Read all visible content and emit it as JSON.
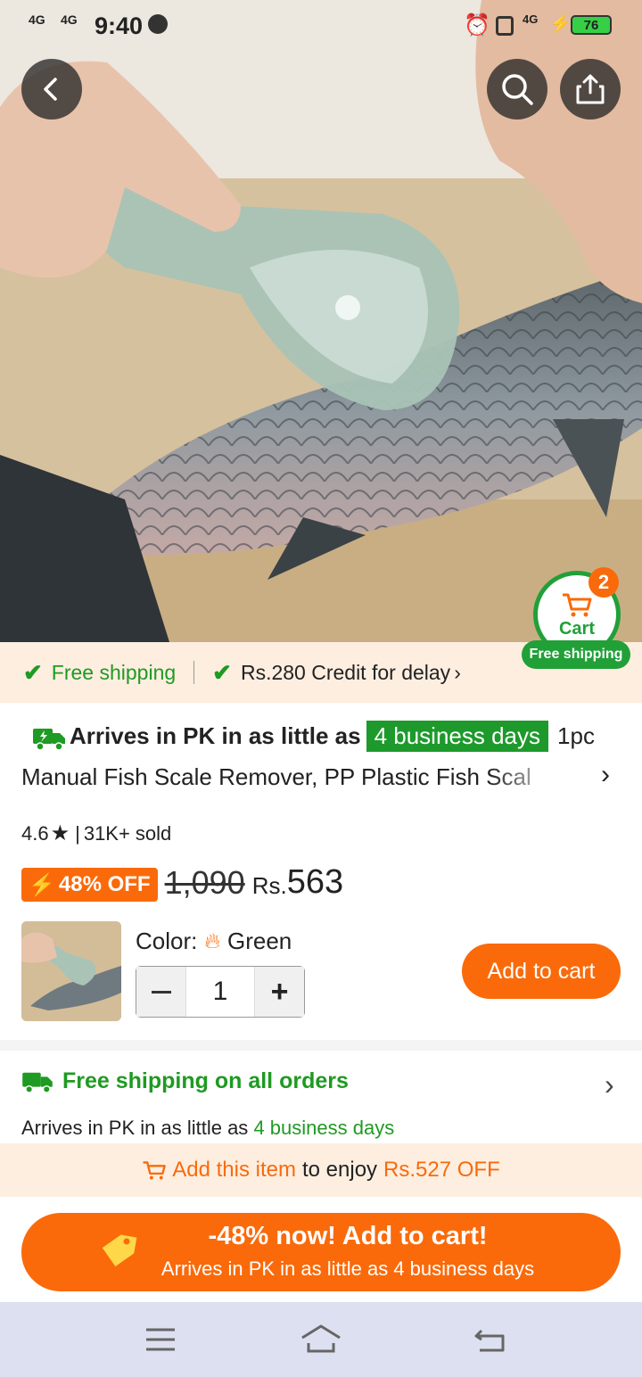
{
  "status_bar": {
    "network1": "4G",
    "network2": "4G",
    "time": "9:40",
    "network3": "4G",
    "battery": "76"
  },
  "cart": {
    "label": "Cart",
    "count": "2",
    "free_shipping": "Free shipping"
  },
  "shipping_strip": {
    "free_shipping": "Free shipping",
    "credit": "Rs.280 Credit for delay"
  },
  "product": {
    "arrives_prefix": "Arrives in PK in as little as",
    "arrives_days": "4 business days",
    "qty_label": "1pc",
    "title": "Manual Fish Scale Remover, PP Plastic Fish Scal",
    "rating": "4.6",
    "sold": "31K+ sold",
    "discount": "48% OFF",
    "old_price": "1,090",
    "currency": "Rs.",
    "price": "563",
    "color_label": "Color:",
    "color_value": "Green",
    "quantity": "1",
    "add_to_cart": "Add to cart"
  },
  "shipping_section": {
    "title": "Free shipping on all orders",
    "arrives_prefix": "Arrives in PK in as little as",
    "arrives_days": "4 business days"
  },
  "promo": {
    "add_item": "Add this item",
    "middle": "to enjoy",
    "amount": "Rs.527 OFF"
  },
  "cta": {
    "title": "-48% now! Add to cart!",
    "subtitle": "Arrives in PK in as little as 4 business days"
  },
  "colors": {
    "accent_orange": "#fa6a0a",
    "accent_green": "#1f9a22",
    "strip_bg": "#fdeee0"
  }
}
